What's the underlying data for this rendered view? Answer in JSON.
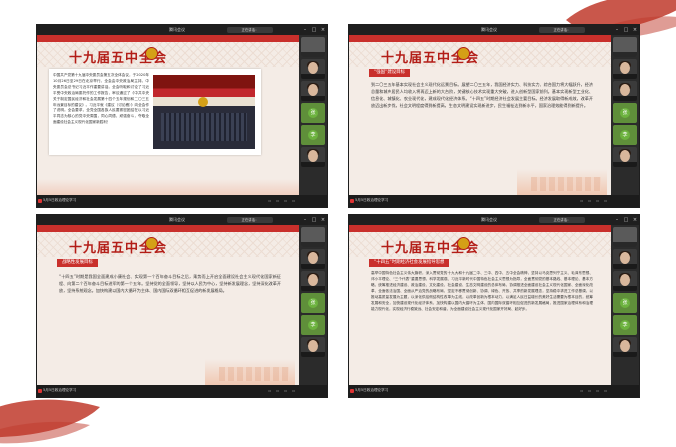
{
  "meeting": {
    "window_title": "腾讯会议",
    "status_pill": "正在讲话：",
    "presenter_label": "5月5日政治理论学习",
    "slide_title": "十九届五中全会"
  },
  "panels": [
    {
      "heading_tag": "",
      "body": "中国共产党第十九届中央委员会第五次全体会议，于2020年10月26日至29日在北京举行。全会由中央政治局主持。中央委员会总书记习近平作重要讲话。全会听取和讨论了习近平受中央政治局委托作的工作报告，审议通过了《中共中央关于制定国民经济和社会发展第十四个五年规划和二〇三五年远景目标的建议》。习近平就《建议（讨论稿）》向全会作了说明。全会要求，全党全国各族人民要紧密团结在以习近平同志为核心的党中央周围，同心同德，顽强奋斗，夺取全面建设社会主义现代化国家新胜利！"
    },
    {
      "heading_tag": "“强国”建设目标",
      "body": "到二〇三五年基本实现社会主义现代化远景目标。展望二〇三五年，我国经济实力、科技实力、综合国力将大幅跃升，经济总量和城乡居民人均收入将再迈上新的大台阶，关键核心技术实现重大突破，进入创新型国家前列。基本实现新型工业化、信息化、城镇化、农业现代化，建成现代化经济体系。“十四五”时期经济社会发展主要目标。经济发展取得新成效，改革开放迈出新步伐，社会文明程度得到新提高，生态文明建设实现新进步，民生福祉达到新水平，国家治理效能得到新提升。"
    },
    {
      "heading_tag": "战略性发展目标",
      "body": "“十四五”时期是我国全面建成小康社会、实现第一个百年奋斗目标之后，乘势而上开启全面建设社会主义现代化国家新征程、向第二个百年奋斗目标进军的第一个五年。坚持党的全面领导，坚持以人民为中心，坚持新发展理念，坚持深化改革开放，坚持系统观念。加快构建以国内大循环为主体、国内国际双循环相互促进的新发展格局。"
    },
    {
      "heading_tag": "“十四五”时期经济社会发展指导思想",
      "body": "高举中国特色社会主义伟大旗帜，深入贯彻党的十九大和十九届二中、三中、四中、五中全会精神，坚持以马克思列宁主义、毛泽东思想、邓小平理论、“三个代表”重要思想、科学发展观、习近平新时代中国特色社会主义思想为指导，全面贯彻党的基本路线、基本理论、基本方略，统筹推进经济建设、政治建设、文化建设、社会建设、生态文明建设的总体布局，协调推进全面建设社会主义现代化国家、全面深化改革、全面依法治国、全面从严治党的战略布局，坚定不移贯彻创新、协调、绿色、开放、共享的新发展理念，坚持稳中求进工作总基调，以推动高质量发展为主题，以深化供给侧结构性改革为主线，以改革创新为根本动力，以满足人民日益增长的美好生活需要为根本目的，统筹发展和安全，加快建设现代化经济体系，加快构建以国内大循环为主体、国内国际双循环相互促进的新发展格局，推进国家治理体系和治理能力现代化，实现经济行稳致远、社会安定和谐，为全面建设社会主义现代化国家开好局、起好步。"
    }
  ],
  "participants": [
    {
      "label": ""
    },
    {
      "label": ""
    },
    {
      "label": ""
    },
    {
      "label": "张"
    },
    {
      "label": "李"
    },
    {
      "label": ""
    }
  ],
  "colors": {
    "accent_red": "#c9302c",
    "title_red": "#b31d17",
    "brush_red": "#c0392b"
  }
}
